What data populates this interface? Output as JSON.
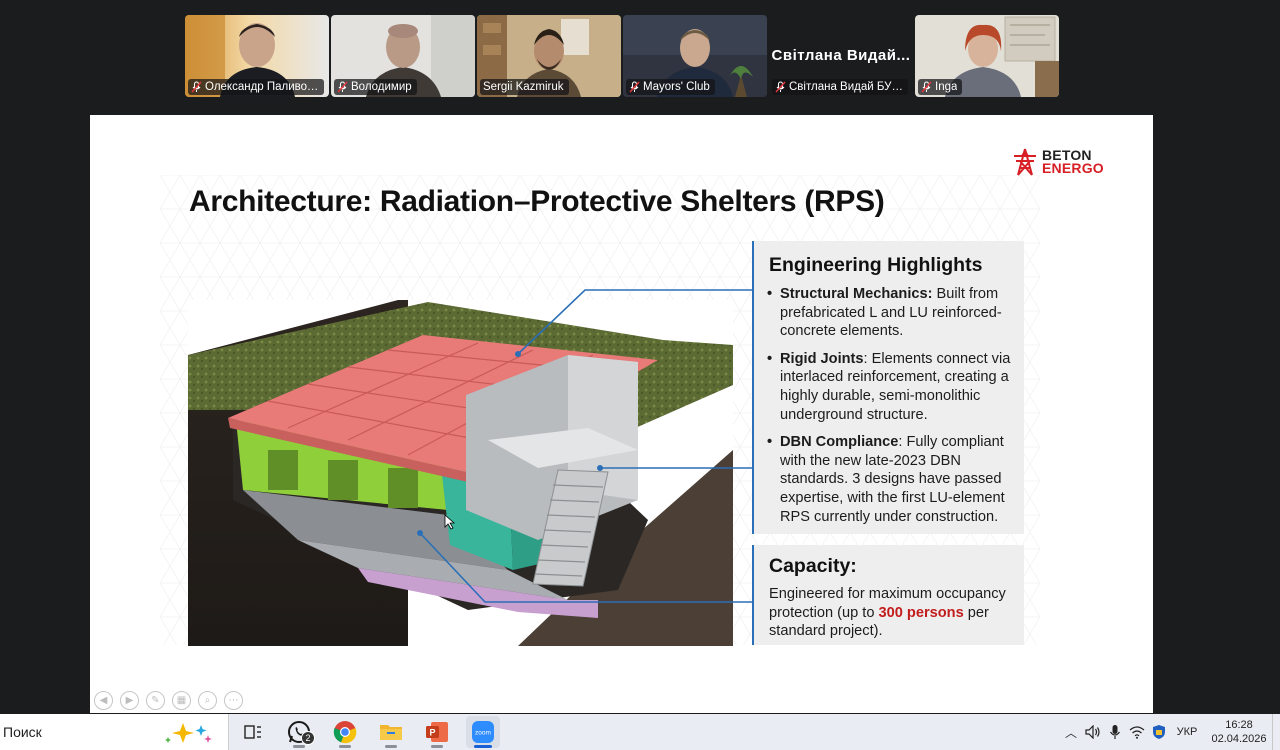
{
  "participants": [
    {
      "name": "Олександр Паливода",
      "muted": true,
      "video": true,
      "active": false
    },
    {
      "name": "Володимир",
      "muted": true,
      "video": true,
      "active": false
    },
    {
      "name": "Sergii Kazmiruk",
      "muted": false,
      "video": true,
      "active": true
    },
    {
      "name": "Mayors' Club",
      "muted": true,
      "video": true,
      "active": false
    },
    {
      "name": "Світлана Видай БУРШ...",
      "display_name": "Світлана  Видай...",
      "muted": true,
      "video": false,
      "active": false
    },
    {
      "name": "Inga",
      "muted": true,
      "video": true,
      "active": false
    }
  ],
  "slide": {
    "logo_line1": "BETON",
    "logo_line2": "ENERGO",
    "title": "Architecture: Radiation–Protective Shelters (RPS)",
    "highlights_heading": "Engineering Highlights",
    "bullets": [
      {
        "label": "Structural Mechanics:",
        "text": " Built from prefabricated L and LU reinforced-concrete elements."
      },
      {
        "label": "Rigid Joints",
        "text": ": Elements connect via interlaced reinforcement, creating a highly durable, semi-monolithic underground structure."
      },
      {
        "label": "DBN Compliance",
        "text": ": Fully compliant with the new late-2023 DBN standards. 3 designs have passed expertise, with the first LU-element RPS currently under construction."
      }
    ],
    "capacity_heading": "Capacity:",
    "capacity_pre": "Engineered for maximum occupancy protection (up to ",
    "capacity_highlight": "300 persons",
    "capacity_post": " per standard project)."
  },
  "taskbar": {
    "search_label": "Поиск",
    "whatsapp_badge": "2",
    "language": "УКР",
    "time": "16:28",
    "date": "02.04.2026"
  },
  "colors": {
    "accent_blue": "#2a6fb7",
    "brand_red": "#d71f26",
    "active_speaker": "#2ed46f"
  }
}
